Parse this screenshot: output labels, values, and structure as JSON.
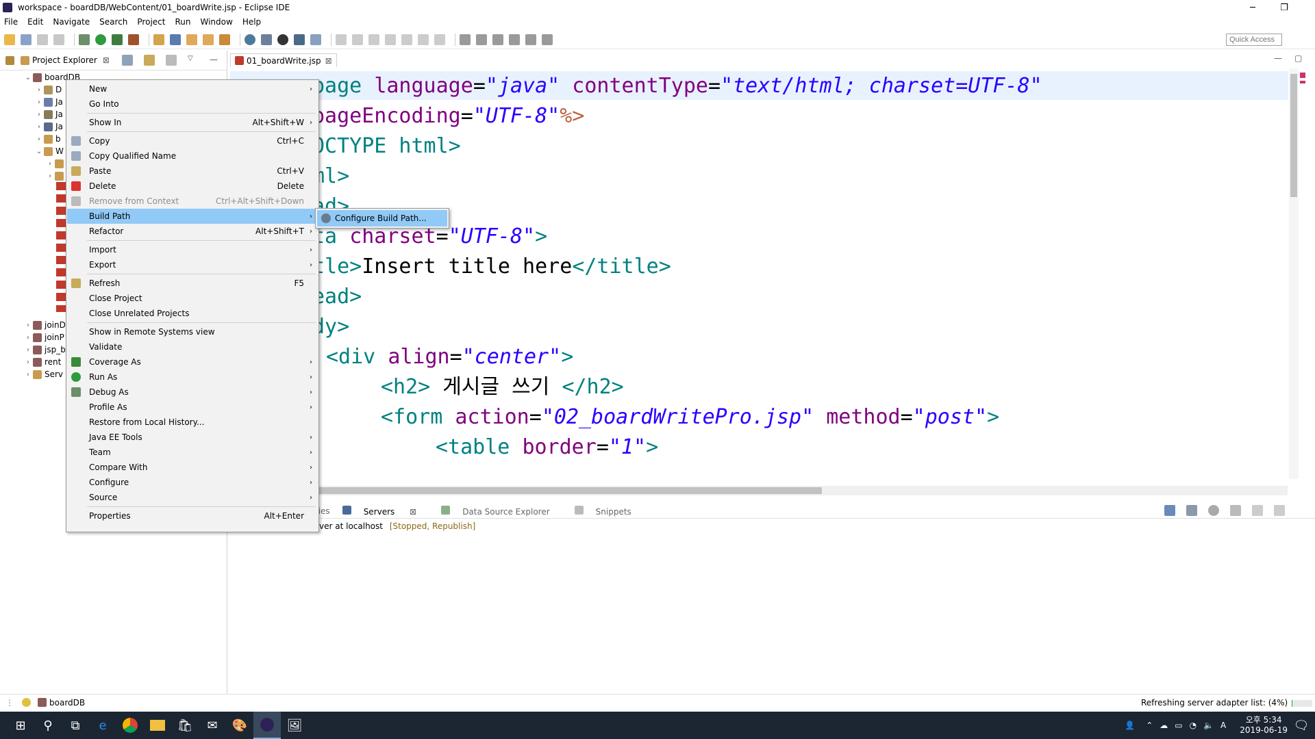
{
  "window": {
    "title": "workspace - boardDB/WebContent/01_boardWrite.jsp - Eclipse IDE",
    "minimize": "─",
    "restore": "❐",
    "close": "✕"
  },
  "menubar": [
    "File",
    "Edit",
    "Navigate",
    "Search",
    "Project",
    "Run",
    "Window",
    "Help"
  ],
  "toolbar": {
    "quick_access": "Quick Access"
  },
  "project_explorer": {
    "tab": "Project Explorer",
    "root": "boardDB",
    "children": [
      "D",
      "Ja",
      "Ja",
      "Ja",
      "b",
      "W"
    ],
    "others": [
      "joinD",
      "joinP",
      "jsp_b",
      "rent",
      "Serv"
    ]
  },
  "editor": {
    "tab": "01_boardWrite.jsp",
    "lines": [
      {
        "prefix": "page ",
        "attr1": "language",
        "eq1": "=",
        "val1": "\"java\"",
        "attr2": " contentType",
        "eq2": "=",
        "val2": "\"text/html; charset=UTF-8\""
      },
      {
        "attr": "pageEncoding",
        "eq": "=",
        "val": "\"UTF-8\"",
        "end": "%>"
      },
      "OCTYPE html>",
      "ml>",
      "ad>",
      {
        "tag": "ta ",
        "attr": "charset",
        "eq": "=",
        "val": "\"UTF-8\"",
        "end": ">"
      },
      {
        "open": "tle>",
        "text": "Insert title here",
        "close": "</title>"
      },
      "ead>",
      "dy>",
      {
        "tag": "<div ",
        "attr": "align",
        "eq": "=",
        "val": "\"center\"",
        "end": ">"
      },
      {
        "open": "<h2>",
        "text": " 게시글 쓰기 ",
        "close": "</h2>"
      },
      {
        "tag": "<form ",
        "attr": "action",
        "eq": "=",
        "val": "\"02_boardWritePro.jsp\"",
        "attr2": " method",
        "eq2": "=",
        "val2": "\"post\"",
        "end": ">"
      },
      {
        "tag": "<table ",
        "attr": "border",
        "eq": "=",
        "val": "\"1\"",
        "end": ">"
      }
    ]
  },
  "context_menu": [
    {
      "label": "New",
      "shortcut": "",
      "submenu": true
    },
    {
      "label": "Go Into",
      "shortcut": ""
    },
    {
      "sep": true
    },
    {
      "label": "Show In",
      "shortcut": "Alt+Shift+W",
      "submenu": true
    },
    {
      "sep": true
    },
    {
      "label": "Copy",
      "shortcut": "Ctrl+C",
      "icon": "copy-icon"
    },
    {
      "label": "Copy Qualified Name",
      "shortcut": "",
      "icon": "copy-icon"
    },
    {
      "label": "Paste",
      "shortcut": "Ctrl+V",
      "icon": "paste-icon"
    },
    {
      "label": "Delete",
      "shortcut": "Delete",
      "icon": "delete-icon"
    },
    {
      "label": "Remove from Context",
      "shortcut": "Ctrl+Alt+Shift+Down",
      "disabled": true,
      "icon": "remove-icon"
    },
    {
      "label": "Build Path",
      "shortcut": "",
      "submenu": true,
      "highlight": true
    },
    {
      "label": "Refactor",
      "shortcut": "Alt+Shift+T",
      "submenu": true
    },
    {
      "sep": true
    },
    {
      "label": "Import",
      "shortcut": "",
      "submenu": true
    },
    {
      "label": "Export",
      "shortcut": "",
      "submenu": true
    },
    {
      "sep": true
    },
    {
      "label": "Refresh",
      "shortcut": "F5",
      "icon": "refresh-icon"
    },
    {
      "label": "Close Project",
      "shortcut": ""
    },
    {
      "label": "Close Unrelated Projects",
      "shortcut": ""
    },
    {
      "sep": true
    },
    {
      "label": "Show in Remote Systems view",
      "shortcut": ""
    },
    {
      "label": "Validate",
      "shortcut": ""
    },
    {
      "label": "Coverage As",
      "shortcut": "",
      "submenu": true,
      "icon": "coverage-icon"
    },
    {
      "label": "Run As",
      "shortcut": "",
      "submenu": true,
      "icon": "run-icon"
    },
    {
      "label": "Debug As",
      "shortcut": "",
      "submenu": true,
      "icon": "debug-icon"
    },
    {
      "label": "Profile As",
      "shortcut": "",
      "submenu": true
    },
    {
      "label": "Restore from Local History...",
      "shortcut": ""
    },
    {
      "label": "Java EE Tools",
      "shortcut": "",
      "submenu": true
    },
    {
      "label": "Team",
      "shortcut": "",
      "submenu": true
    },
    {
      "label": "Compare With",
      "shortcut": "",
      "submenu": true
    },
    {
      "label": "Configure",
      "shortcut": "",
      "submenu": true
    },
    {
      "label": "Source",
      "shortcut": "",
      "submenu": true
    },
    {
      "sep": true
    },
    {
      "label": "Properties",
      "shortcut": "Alt+Enter"
    }
  ],
  "submenu": {
    "label": "Configure Build Path..."
  },
  "bottom_panel": {
    "tabs": [
      "ties",
      "Servers",
      "Data Source Explorer",
      "Snippets"
    ],
    "server_text": "ver at localhost",
    "server_status": "[Stopped, Republish]"
  },
  "statusbar": {
    "selected": "boardDB",
    "progress": "Refreshing server adapter list: (4%)",
    "progress_fraction": 0.04
  },
  "taskbar": {
    "time": "오후 5:34",
    "date": "2019-06-19",
    "ime": "A"
  }
}
